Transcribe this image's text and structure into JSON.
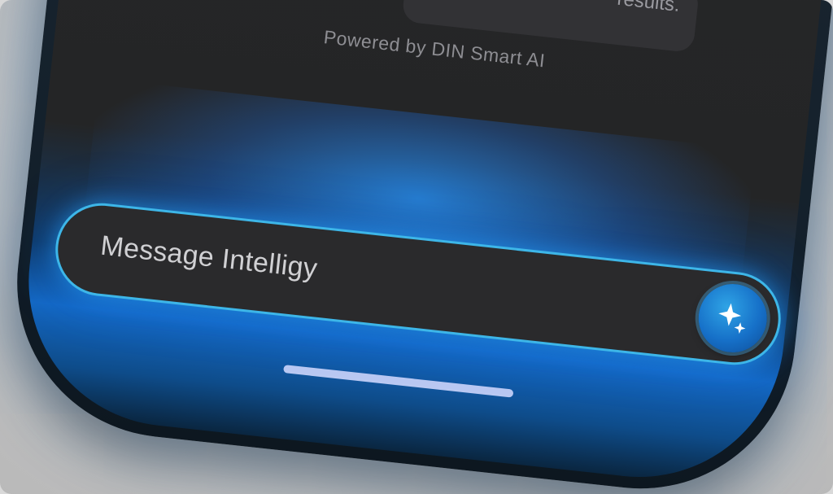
{
  "screen": {
    "card_text": "results.",
    "powered_by": "Powered by DIN Smart AI"
  },
  "input": {
    "placeholder": "Message Intelligy"
  },
  "send_button": {
    "icon": "sparkles-icon"
  },
  "colors": {
    "accent": "#3db6e8",
    "button": "#1670c8",
    "glow": "#1468c4"
  }
}
